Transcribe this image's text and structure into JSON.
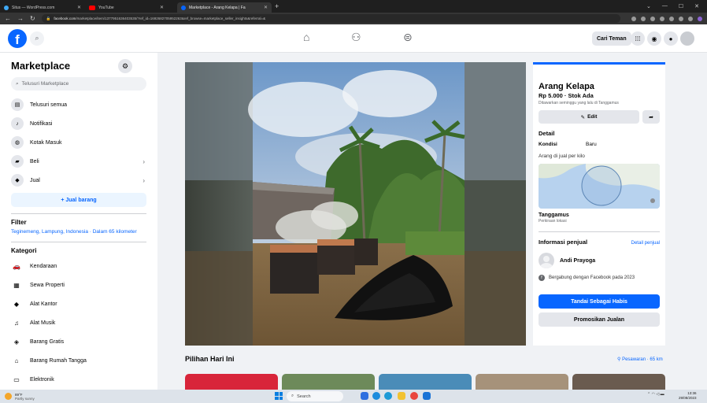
{
  "browser": {
    "tabs": [
      {
        "label": "Situs — WordPress.com",
        "color": "#3fa9f5"
      },
      {
        "label": "YouTube",
        "color": "#ff0000"
      },
      {
        "label": "Marketplace - Arang Kelapa | Fa",
        "color": "#0866ff"
      }
    ],
    "new_tab": "+",
    "url_host": "facebook.com",
    "url_rest": "/marketplace/item/1377951636403535/?ref_id=1692682705952263&ref_browse=marketplace_seller_insights&referral=&",
    "window_controls": [
      "⌄",
      "—",
      "☐",
      "✕"
    ]
  },
  "fb": {
    "logo": "f",
    "cari_teman": "Cari Teman"
  },
  "sidebar": {
    "title": "Marketplace",
    "search_placeholder": "Telusuri Marketplace",
    "items": [
      {
        "label": "Telusuri semua",
        "icon": "shop-icon"
      },
      {
        "label": "Notifikasi",
        "icon": "bell-icon"
      },
      {
        "label": "Kotak Masuk",
        "icon": "messenger-icon"
      },
      {
        "label": "Beli",
        "icon": "bag-icon"
      },
      {
        "label": "Jual",
        "icon": "tag-icon"
      }
    ],
    "jual_barang": "+ Jual barang",
    "filter_heading": "Filter",
    "filter_location": "Teginemeng, Lampung, Indonesia · Dalam 65 kilometer",
    "kategori_heading": "Kategori",
    "categories": [
      {
        "label": "Kendaraan",
        "icon": "car-icon"
      },
      {
        "label": "Sewa Properti",
        "icon": "building-icon"
      },
      {
        "label": "Alat Kantor",
        "icon": "tag-icon"
      },
      {
        "label": "Alat Musik",
        "icon": "guitar-icon"
      },
      {
        "label": "Barang Gratis",
        "icon": "gift-tag-icon"
      },
      {
        "label": "Barang Rumah Tangga",
        "icon": "house-icon"
      },
      {
        "label": "Elektronik",
        "icon": "monitor-icon"
      }
    ]
  },
  "listing": {
    "title": "Arang Kelapa",
    "price": "Rp 5.000 · Stok Ada",
    "listed": "Ditawarkan seminggu yang lalu di Tanggamus",
    "edit": "Edit",
    "detail_heading": "Detail",
    "kondisi_label": "Kondisi",
    "kondisi_value": "Baru",
    "description": "Arang di jual per kilo",
    "location": "Tanggamus",
    "location_note": "Perkiraan lokasi",
    "seller_heading": "Informasi penjual",
    "seller_link": "Detail penjual",
    "seller_name": "Andi Prayoga",
    "joined": "Bergabung dengan Facebook pada 2023",
    "mark_sold": "Tandai Sebagai Habis",
    "promote": "Promosikan Jualan"
  },
  "picks": {
    "title": "Pilihan Hari Ini",
    "location": "Pesawaran · 65 km"
  },
  "taskbar": {
    "temp": "89°F",
    "weather": "Partly sunny",
    "search": "Search",
    "time": "13:36",
    "date": "29/08/2023"
  }
}
